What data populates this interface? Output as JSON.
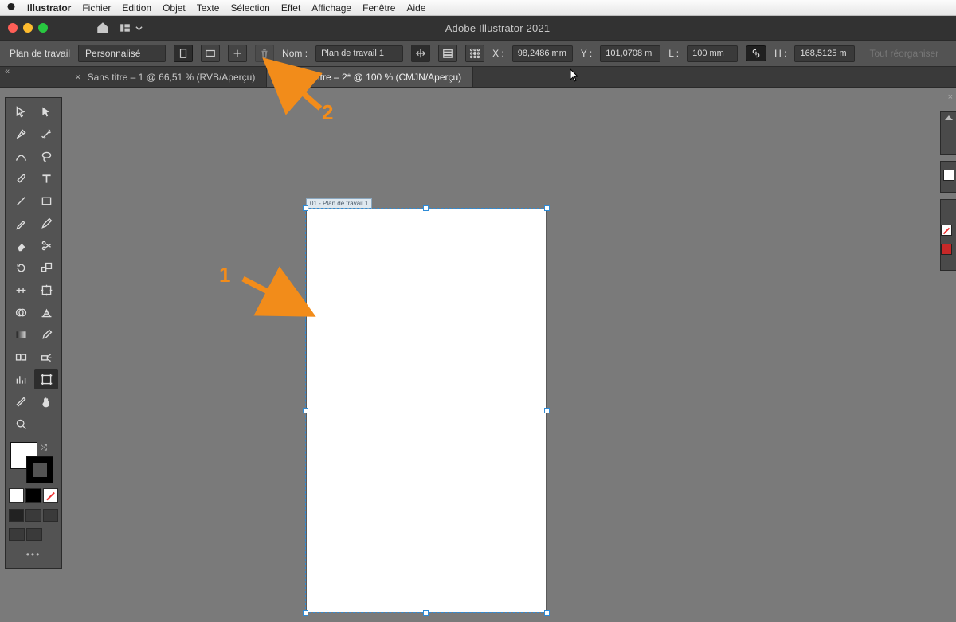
{
  "mac_menu": {
    "app": "Illustrator",
    "items": [
      "Fichier",
      "Edition",
      "Objet",
      "Texte",
      "Sélection",
      "Effet",
      "Affichage",
      "Fenêtre",
      "Aide"
    ]
  },
  "app_title": "Adobe Illustrator 2021",
  "control_bar": {
    "mode_label": "Plan de travail",
    "preset": "Personnalisé",
    "name_label": "Nom :",
    "name_value": "Plan de travail 1",
    "x_label": "X :",
    "x_value": "98,2486 mm",
    "y_label": "Y :",
    "y_value": "101,0708 m",
    "w_label": "L :",
    "w_value": "100 mm",
    "h_label": "H :",
    "h_value": "168,5125 m",
    "reorganize": "Tout réorganiser"
  },
  "tabs": [
    {
      "label": "Sans titre – 1 @ 66,51 % (RVB/Aperçu)",
      "active": false
    },
    {
      "label": "Sans titre – 2* @ 100 % (CMJN/Aperçu)",
      "active": true
    }
  ],
  "artboard_tag": "01 - Plan de travail 1",
  "annotations": {
    "one": "1",
    "two": "2"
  }
}
